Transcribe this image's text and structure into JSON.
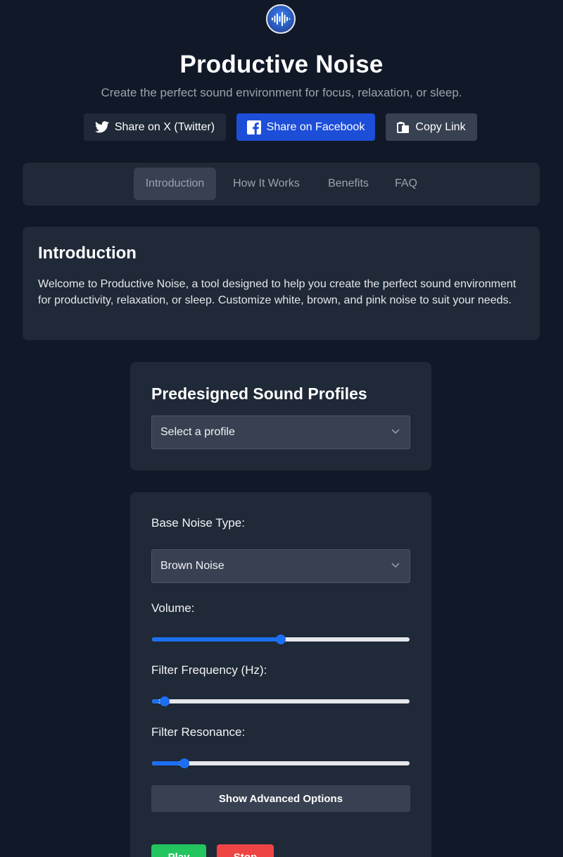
{
  "header": {
    "title": "Productive Noise",
    "subtitle": "Create the perfect sound environment for focus, relaxation, or sleep."
  },
  "share": {
    "twitter_label": "Share on X (Twitter)",
    "facebook_label": "Share on Facebook",
    "copy_label": "Copy Link"
  },
  "tabs": [
    {
      "label": "Introduction",
      "active": true
    },
    {
      "label": "How It Works",
      "active": false
    },
    {
      "label": "Benefits",
      "active": false
    },
    {
      "label": "FAQ",
      "active": false
    }
  ],
  "intro": {
    "heading": "Introduction",
    "body": "Welcome to Productive Noise, a tool designed to help you create the perfect sound environment for productivity, relaxation, or sleep. Customize white, brown, and pink noise to suit your needs."
  },
  "profiles": {
    "heading": "Predesigned Sound Profiles",
    "selected": "Select a profile"
  },
  "controls": {
    "noise_type_label": "Base Noise Type:",
    "noise_type_selected": "Brown Noise",
    "volume_label": "Volume:",
    "volume_fraction": 0.5,
    "filter_freq_label": "Filter Frequency (Hz):",
    "filter_freq_fraction": 0.03,
    "filter_res_label": "Filter Resonance:",
    "filter_res_fraction": 0.11,
    "advanced_label": "Show Advanced Options",
    "play_label": "Play",
    "stop_label": "Stop"
  },
  "colors": {
    "background": "#111827",
    "card": "#1f2937",
    "accent": "#1d6ff2",
    "facebook": "#1d4ed8",
    "play": "#22c55e",
    "stop": "#ef4444"
  }
}
